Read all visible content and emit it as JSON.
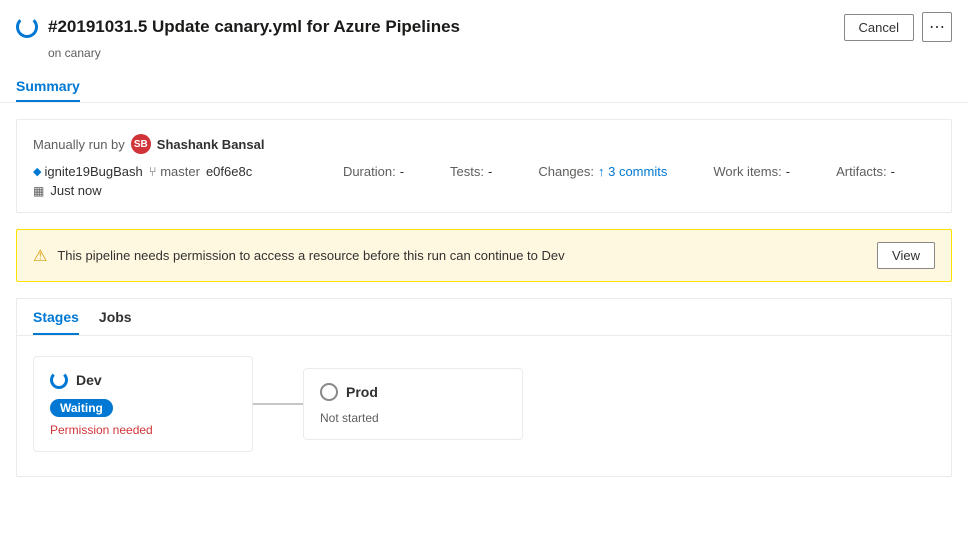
{
  "header": {
    "pipeline_number": "#20191031.5",
    "title": "Update canary.yml for Azure Pipelines",
    "subtitle": "on canary",
    "cancel_label": "Cancel"
  },
  "tabs": [
    {
      "id": "summary",
      "label": "Summary",
      "active": true
    },
    {
      "id": "jobs",
      "label": "Jobs",
      "active": false
    }
  ],
  "info_card": {
    "manually_run_label": "Manually run by",
    "user_name": "Shashank Bansal",
    "branch_name": "ignite19BugBash",
    "git_icon": "🔀",
    "branch_ref": "master",
    "commit_hash": "e0f6e8c",
    "duration_label": "Duration:",
    "duration_value": "-",
    "tests_label": "Tests:",
    "tests_value": "-",
    "changes_label": "Changes:",
    "changes_value": "↑ 3 commits",
    "work_items_label": "Work items:",
    "work_items_value": "-",
    "artifacts_label": "Artifacts:",
    "artifacts_value": "-",
    "time_label": "Just now"
  },
  "warning": {
    "text": "This pipeline needs permission to access a resource before this run can continue to Dev",
    "view_label": "View"
  },
  "stages": {
    "tabs": [
      {
        "id": "stages",
        "label": "Stages",
        "active": true
      },
      {
        "id": "jobs",
        "label": "Jobs",
        "active": false
      }
    ],
    "cards": [
      {
        "id": "dev",
        "name": "Dev",
        "status": "waiting",
        "badge": "Waiting",
        "sub_text": "Permission needed"
      },
      {
        "id": "prod",
        "name": "Prod",
        "status": "notstarted",
        "sub_text": "Not started"
      }
    ]
  }
}
